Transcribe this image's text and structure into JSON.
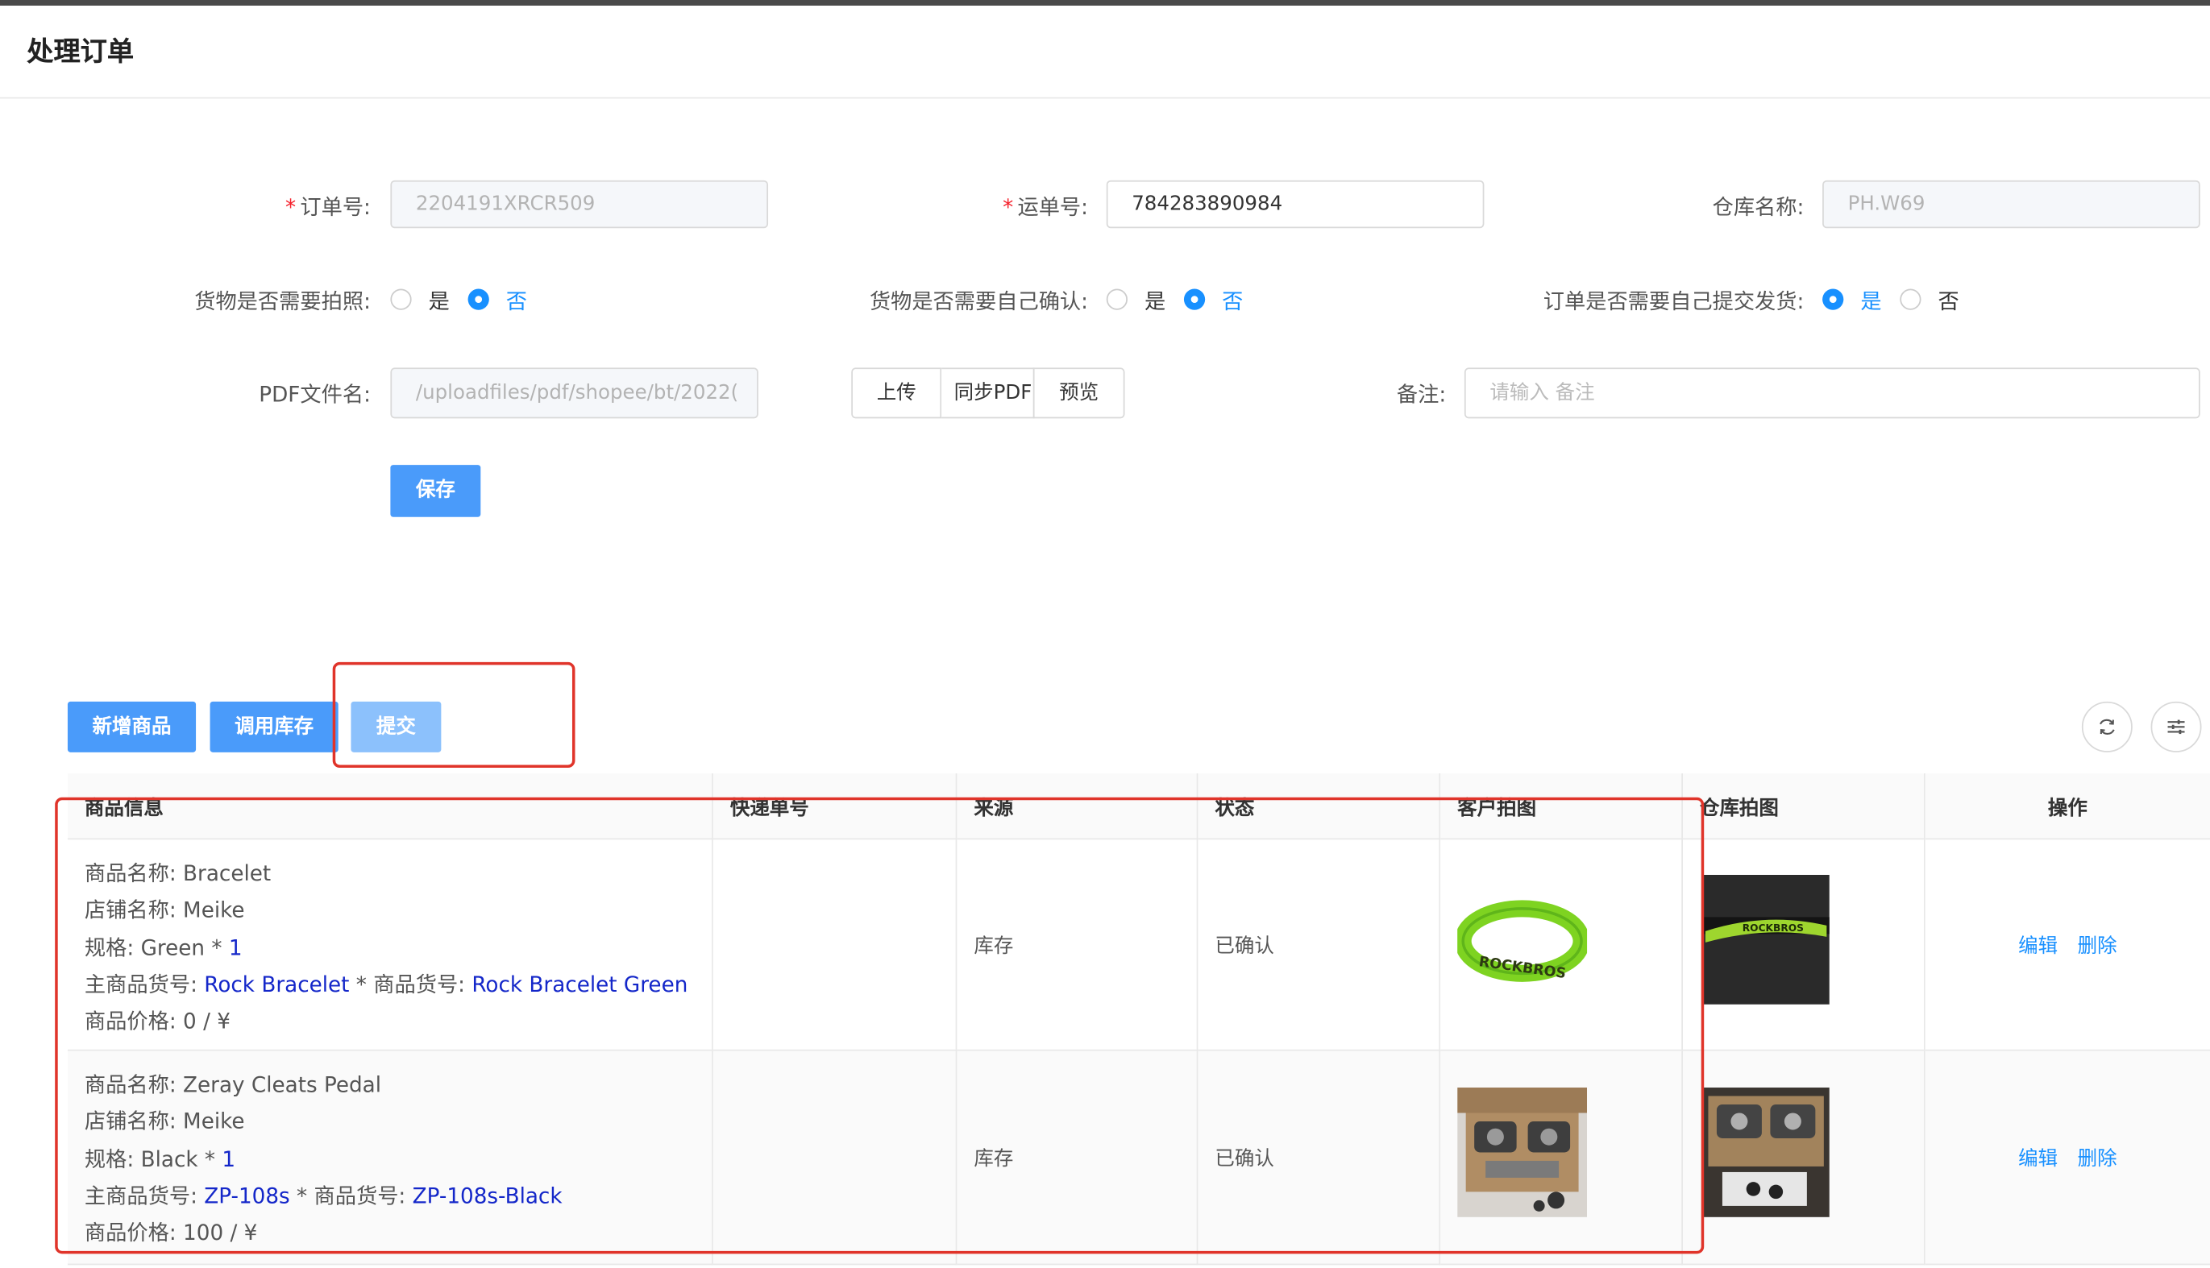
{
  "page": {
    "title": "处理订单"
  },
  "form": {
    "order_no": {
      "label": "订单号:",
      "value": "2204191XRCR509"
    },
    "tracking_no": {
      "label": "运单号:",
      "value": "784283890984"
    },
    "warehouse": {
      "label": "仓库名称:",
      "value": "PH.W69"
    },
    "need_photo": {
      "label": "货物是否需要拍照:",
      "yes": "是",
      "no": "否",
      "selected": "否"
    },
    "need_confirm": {
      "label": "货物是否需要自己确认:",
      "yes": "是",
      "no": "否",
      "selected": "否"
    },
    "need_ship": {
      "label": "订单是否需要自己提交发货:",
      "yes": "是",
      "no": "否",
      "selected": "是"
    },
    "pdf": {
      "label": "PDF文件名:",
      "value": "/uploadfiles/pdf/shopee/bt/2022("
    },
    "upload_btn": "上传",
    "sync_btn": "同步PDF",
    "preview_btn": "预览",
    "remark": {
      "label": "备注:",
      "placeholder": "请输入 备注"
    },
    "save_btn": "保存"
  },
  "toolbar": {
    "add_btn": "新增商品",
    "stock_btn": "调用库存",
    "submit_btn": "提交"
  },
  "table": {
    "headers": [
      "商品信息",
      "快递单号",
      "来源",
      "状态",
      "客户拍图",
      "仓库拍图",
      "操作"
    ],
    "rows": [
      {
        "name_label": "商品名称:",
        "name": "Bracelet",
        "shop_label": "店铺名称:",
        "shop": "Meike",
        "spec_label": "规格:",
        "spec": "Green",
        "qty_sep": " * ",
        "qty": "1",
        "main_sku_label": "主商品货号:",
        "main_sku": "Rock Bracelet",
        "sku_label": " * 商品货号:",
        "sku": "Rock Bracelet Green",
        "price_label": "商品价格:",
        "price": "0 / ¥",
        "tracking": "",
        "source": "库存",
        "status": "已确认",
        "edit": "编辑",
        "delete": "删除"
      },
      {
        "name_label": "商品名称:",
        "name": "Zeray Cleats Pedal",
        "shop_label": "店铺名称:",
        "shop": "Meike",
        "spec_label": "规格:",
        "spec": "Black",
        "qty_sep": " * ",
        "qty": "1",
        "main_sku_label": "主商品货号:",
        "main_sku": "ZP-108s",
        "sku_label": " * 商品货号:",
        "sku": "ZP-108s-Black",
        "price_label": "商品价格:",
        "price": "100 / ¥",
        "tracking": "",
        "source": "库存",
        "status": "已确认",
        "edit": "编辑",
        "delete": "删除"
      }
    ]
  },
  "images": {
    "bracelet_text": "ROCKBROS",
    "bracelet_text2": "ROCKBROS"
  },
  "colors": {
    "primary": "#1890ff",
    "button": "#4a9bfa",
    "highlight": "#e0342a",
    "link": "#1427c9"
  },
  "icons": [
    "refresh-icon",
    "column-settings-icon"
  ]
}
